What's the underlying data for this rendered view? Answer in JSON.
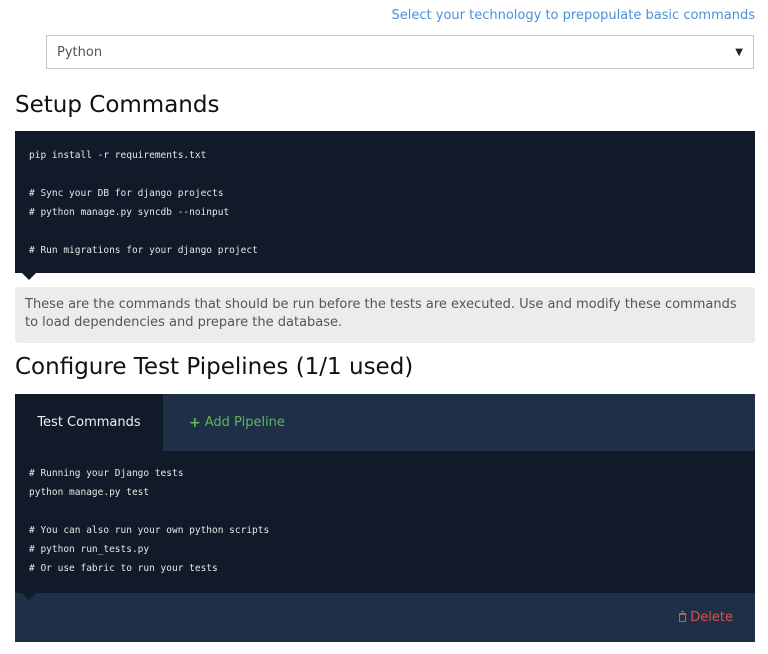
{
  "technology": {
    "hint": "Select your technology to prepopulate basic commands",
    "selected": "Python"
  },
  "setup": {
    "title": "Setup Commands",
    "code": "pip install -r requirements.txt\n\n# Sync your DB for django projects\n# python manage.py syncdb --noinput\n\n# Run migrations for your django project",
    "note": "These are the commands that should be run before the tests are executed. Use and modify these commands to load dependencies and prepare the database."
  },
  "pipelines": {
    "title": "Configure Test Pipelines (1/1 used)",
    "tabs": {
      "active": "Test Commands",
      "add": "Add Pipeline"
    },
    "code": "# Running your Django tests\npython manage.py test\n\n# You can also run your own python scripts\n# python run_tests.py\n# Or use fabric to run your tests",
    "delete_label": "Delete"
  },
  "icons": {
    "add": "plus-icon",
    "delete": "trash-icon",
    "select": "caret-down-icon"
  },
  "colors": {
    "code_bg": "#101a29",
    "panel_bg": "#1f2f48",
    "link": "#4a90d9",
    "add": "#5cb85c",
    "delete": "#d9534f"
  }
}
